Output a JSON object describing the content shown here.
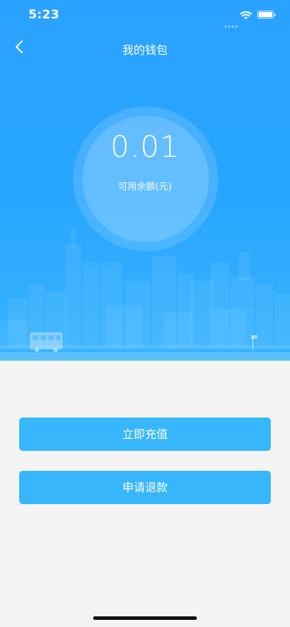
{
  "status_bar": {
    "time": "5:23"
  },
  "nav": {
    "title": "我的钱包",
    "back_icon": "chevron-left-icon"
  },
  "wallet": {
    "balance": "0.01",
    "balance_label": "可用余额(元)"
  },
  "actions": {
    "recharge_label": "立即充值",
    "refund_label": "申请退款"
  },
  "colors": {
    "primary": "#2aa2ff",
    "button": "#37b6fb",
    "background": "#f4f4f4"
  }
}
